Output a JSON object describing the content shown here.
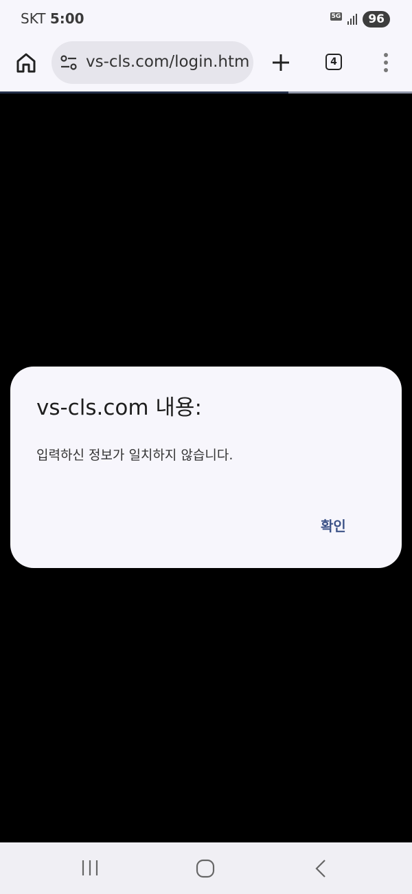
{
  "status_bar": {
    "carrier": "SKT",
    "time": "5:00",
    "network": "5G",
    "battery": "96"
  },
  "toolbar": {
    "url": "vs-cls.com/login.htm",
    "tab_count": "4"
  },
  "dialog": {
    "title": "vs-cls.com 내용:",
    "message": "입력하신 정보가 일치하지 않습니다.",
    "ok_label": "확인"
  },
  "icons": {
    "home": "home-icon",
    "site_settings": "tune-icon",
    "new_tab": "plus-icon",
    "tabs": "tab-switcher-icon",
    "menu": "more-vert-icon",
    "nav_recent": "recent-apps-icon",
    "nav_home": "nav-home-icon",
    "nav_back": "back-icon"
  },
  "colors": {
    "accent": "#3d5388",
    "page_background": "#000000",
    "dialog_background": "#f7f6fc"
  }
}
